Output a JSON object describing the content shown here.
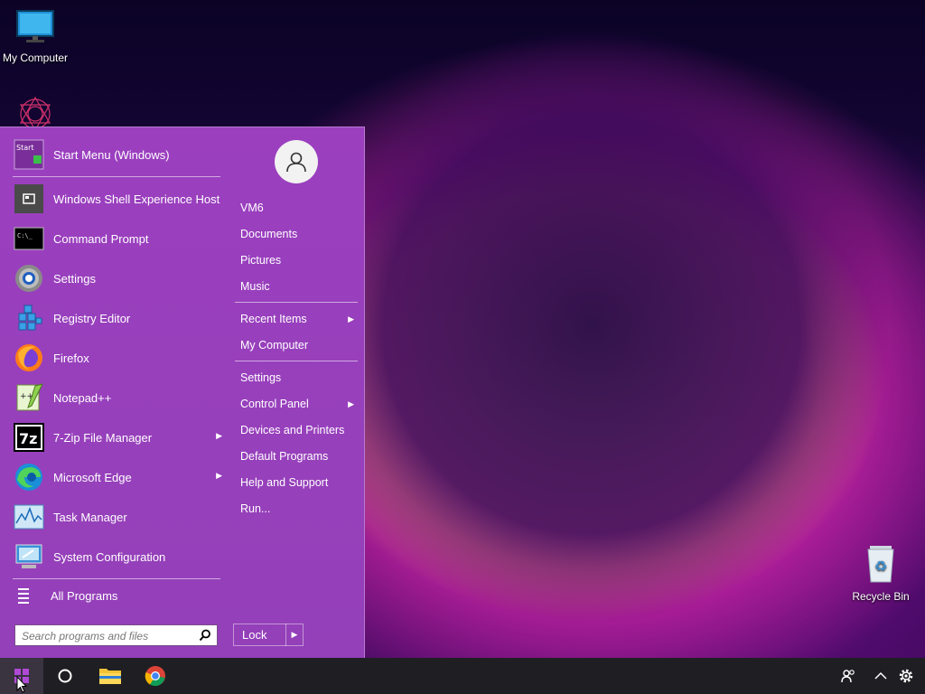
{
  "desktop": {
    "my_computer_label": "My Computer",
    "recycle_bin_label": "Recycle Bin"
  },
  "start_menu": {
    "programs": [
      {
        "label": "Start Menu (Windows)",
        "icon": "start-menu-icon",
        "submenu": false
      },
      {
        "label": "Windows Shell Experience Host",
        "icon": "shell-host-icon",
        "submenu": false
      },
      {
        "label": "Command Prompt",
        "icon": "command-prompt-icon",
        "submenu": false
      },
      {
        "label": "Settings",
        "icon": "settings-gear-icon",
        "submenu": false
      },
      {
        "label": "Registry Editor",
        "icon": "registry-editor-icon",
        "submenu": false
      },
      {
        "label": "Firefox",
        "icon": "firefox-icon",
        "submenu": false
      },
      {
        "label": "Notepad++",
        "icon": "notepad-plus-plus-icon",
        "submenu": false
      },
      {
        "label": "7-Zip File Manager",
        "icon": "seven-zip-icon",
        "submenu": true
      },
      {
        "label": "Microsoft Edge",
        "icon": "edge-icon",
        "submenu": true
      },
      {
        "label": "Task Manager",
        "icon": "task-manager-icon",
        "submenu": false
      },
      {
        "label": "System Configuration",
        "icon": "system-configuration-icon",
        "submenu": false
      }
    ],
    "start_icon_text": "Start",
    "all_programs_label": "All Programs",
    "search_placeholder": "Search programs and files",
    "right_items": {
      "user": "VM6",
      "documents": "Documents",
      "pictures": "Pictures",
      "music": "Music",
      "recent_items": "Recent Items",
      "my_computer": "My Computer",
      "settings": "Settings",
      "control_panel": "Control Panel",
      "devices_printers": "Devices and Printers",
      "default_programs": "Default Programs",
      "help_support": "Help and Support",
      "run": "Run..."
    },
    "lock_label": "Lock"
  },
  "taskbar": {
    "pinned": [
      "start-button",
      "cortana-search",
      "file-explorer",
      "chrome"
    ],
    "tray": [
      "people-icon",
      "show-hidden-icons",
      "settings-icon"
    ]
  },
  "colors": {
    "menu_bg": "#9b3fbf",
    "taskbar_bg": "#1f1f23"
  }
}
